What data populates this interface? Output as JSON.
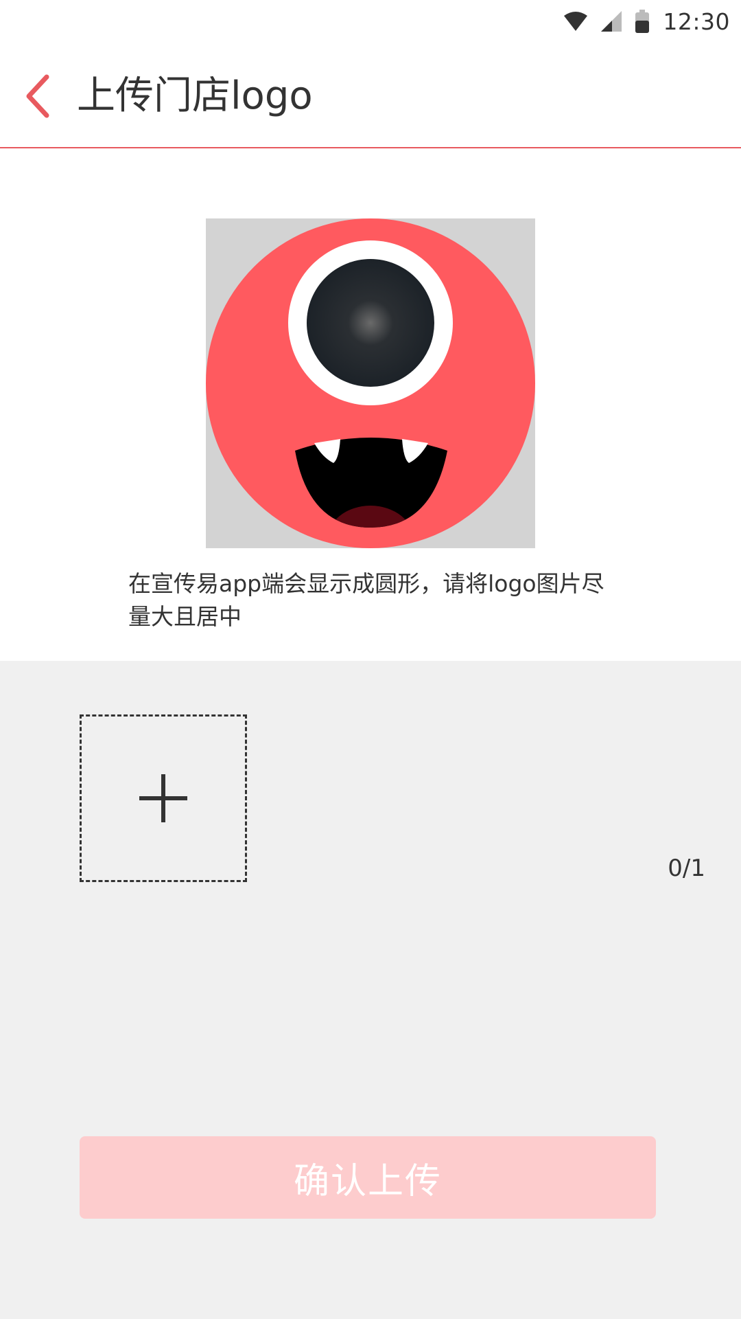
{
  "status_bar": {
    "time": "12:30",
    "icons": [
      "wifi-icon",
      "cell-signal-icon",
      "battery-icon"
    ]
  },
  "header": {
    "back_icon": "chevron-left-icon",
    "title": "上传门店logo"
  },
  "preview": {
    "image_description_icon": "monster-logo",
    "hint": "在宣传易app端会显示成圆形，请将logo图片尽量大且居中"
  },
  "upload": {
    "add_icon": "plus-icon",
    "count": "0/1"
  },
  "actions": {
    "confirm_label": "确认上传"
  },
  "colors": {
    "accent": "#e85a5f",
    "logo_red": "#ff5a5f",
    "button_disabled_bg": "#fdcccd",
    "upload_bg": "#f0f0f0"
  }
}
